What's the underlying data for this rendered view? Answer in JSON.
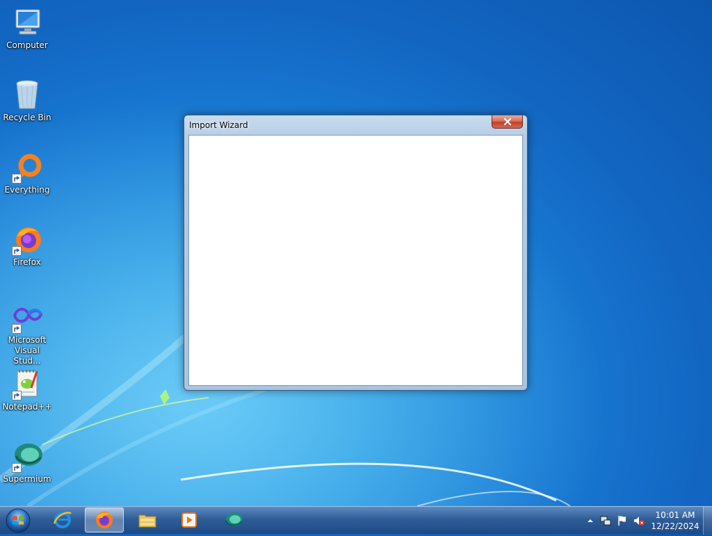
{
  "desktop": {
    "icons": [
      {
        "label": "Computer",
        "icon": "computer-icon",
        "shortcut": false
      },
      {
        "label": "Recycle Bin",
        "icon": "recycle-bin-icon",
        "shortcut": false
      },
      {
        "label": "Everything",
        "icon": "everything-icon",
        "shortcut": true
      },
      {
        "label": "Firefox",
        "icon": "firefox-icon",
        "shortcut": true
      },
      {
        "label": "Microsoft Visual Stud...",
        "icon": "visual-studio-icon",
        "shortcut": true
      },
      {
        "label": "Notepad++",
        "icon": "notepad-plus-plus-icon",
        "shortcut": true
      },
      {
        "label": "Supermium",
        "icon": "supermium-icon",
        "shortcut": true
      }
    ]
  },
  "window": {
    "title": "Import Wizard",
    "close_icon": "close-icon"
  },
  "taskbar": {
    "start_icon": "windows-start-icon",
    "pinned": [
      {
        "name": "internet-explorer",
        "icon": "internet-explorer-icon",
        "active": false
      },
      {
        "name": "firefox",
        "icon": "firefox-icon",
        "active": true
      },
      {
        "name": "file-explorer",
        "icon": "folder-icon",
        "active": false
      },
      {
        "name": "media-player",
        "icon": "media-player-icon",
        "active": false
      },
      {
        "name": "supermium",
        "icon": "supermium-icon",
        "active": false
      }
    ],
    "tray": {
      "icons": [
        "show-hidden-icons-arrow-icon",
        "network-icon",
        "action-center-flag-icon",
        "volume-muted-icon"
      ],
      "time": "10:01 AM",
      "date": "12/22/2024"
    }
  },
  "colors": {
    "desktop_blue": "#1a7ed6",
    "taskbar": "#2f5d98",
    "close_red": "#c0412a"
  }
}
